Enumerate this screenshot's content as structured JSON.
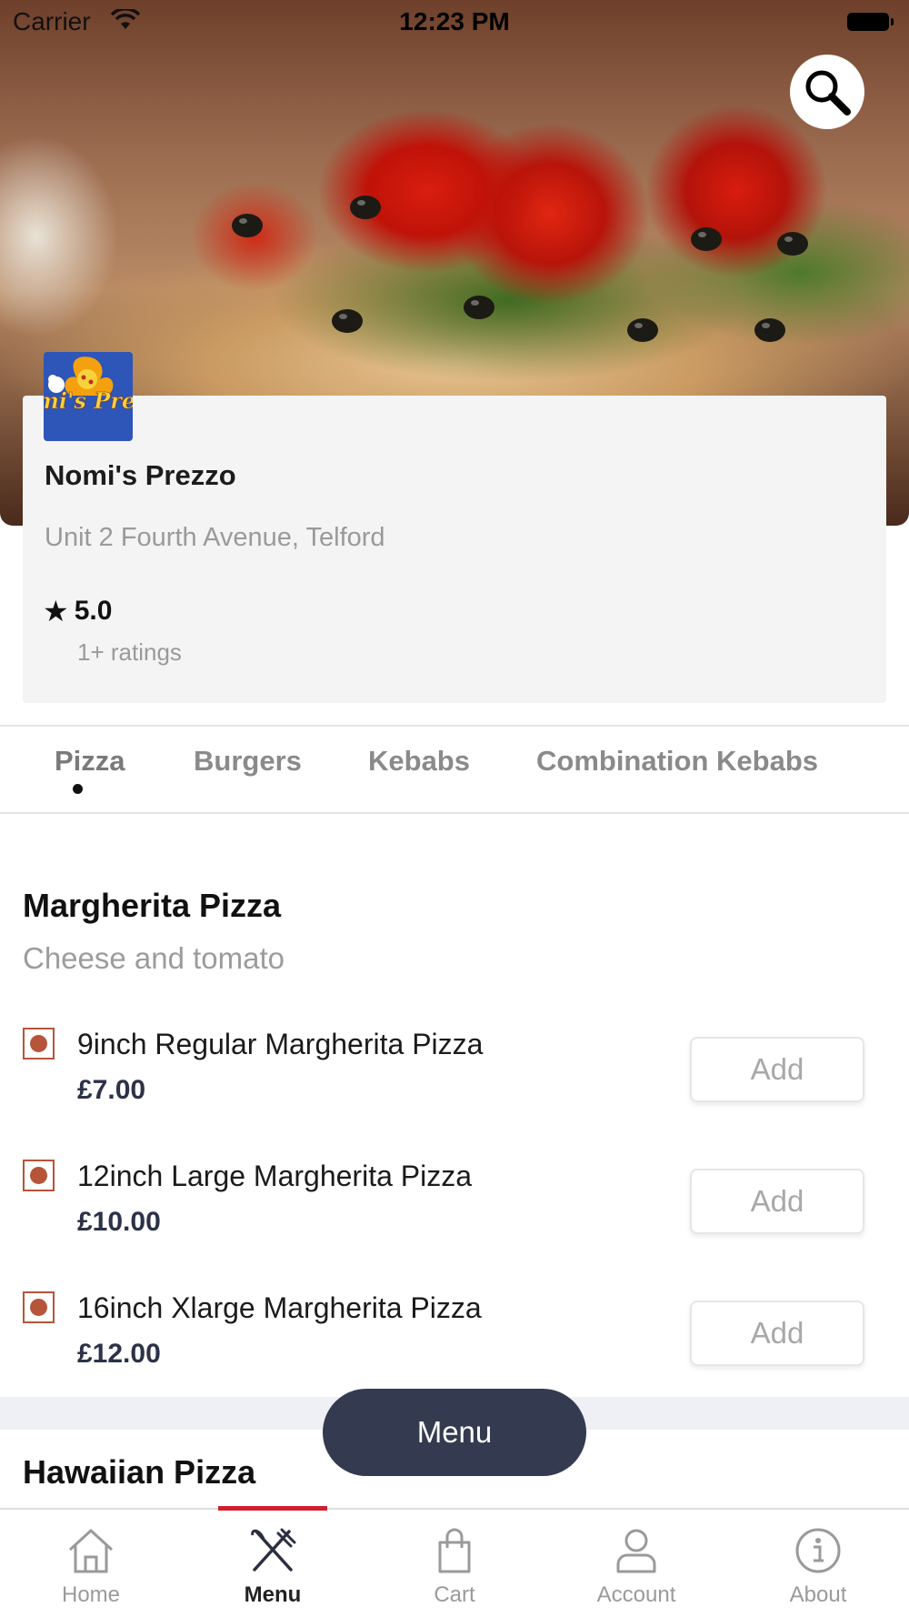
{
  "status_bar": {
    "carrier": "Carrier",
    "time": "12:23 PM"
  },
  "hero": {
    "search_icon": "search-icon"
  },
  "restaurant": {
    "logo_text": "Nomi's Prezzo",
    "name": "Nomi's Prezzo",
    "address": "Unit 2 Fourth Avenue, Telford",
    "rating": "5.0",
    "rating_count": "1+ ratings",
    "rating_icon": "star-icon"
  },
  "tabs": [
    {
      "label": "Pizza",
      "active": true
    },
    {
      "label": "Burgers",
      "active": false
    },
    {
      "label": "Kebabs",
      "active": false
    },
    {
      "label": "Combination Kebabs",
      "active": false
    }
  ],
  "sections": [
    {
      "title": "Margherita Pizza",
      "description": "Cheese and tomato",
      "items": [
        {
          "name": "9inch Regular Margherita Pizza",
          "price": "£7.00",
          "button": "Add"
        },
        {
          "name": "12inch Large Margherita Pizza",
          "price": "£10.00",
          "button": "Add"
        },
        {
          "name": "16inch Xlarge Margherita Pizza",
          "price": "£12.00",
          "button": "Add"
        }
      ]
    },
    {
      "title": "Hawaiian Pizza"
    }
  ],
  "menu_button": "Menu",
  "bottom_nav": [
    {
      "label": "Home",
      "icon": "home-icon",
      "active": false
    },
    {
      "label": "Menu",
      "icon": "fork-knife-icon",
      "active": true
    },
    {
      "label": "Cart",
      "icon": "shopping-bag-icon",
      "active": false
    },
    {
      "label": "Account",
      "icon": "user-icon",
      "active": false
    },
    {
      "label": "About",
      "icon": "info-icon",
      "active": false
    }
  ],
  "colors": {
    "accent": "#d01f2d",
    "fab": "#343a4f",
    "price": "#2c3248",
    "item_marker": "#b6553a",
    "logo_bg": "#2e55b8"
  }
}
